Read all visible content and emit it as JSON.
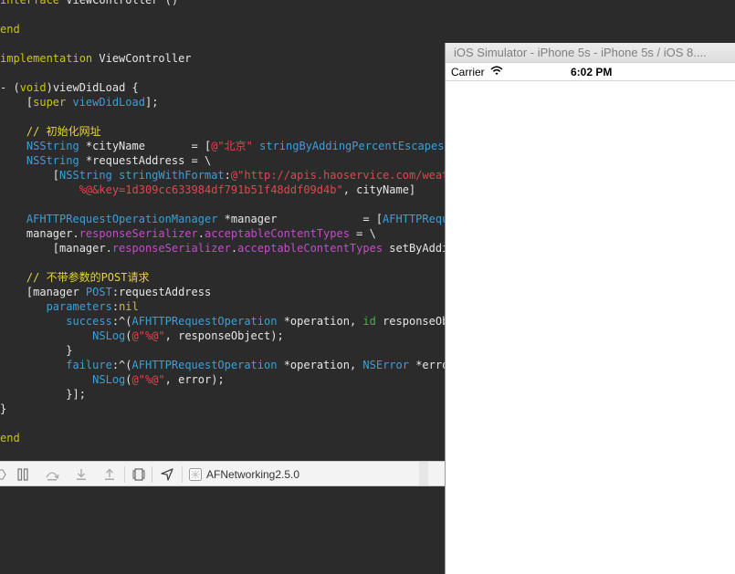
{
  "editor": {
    "lines": [
      [
        [
          "c-kw",
          "interface"
        ],
        [
          "c-pl",
          " ViewController ()"
        ]
      ],
      [],
      [
        [
          "c-kw",
          "end"
        ]
      ],
      [],
      [
        [
          "c-kw",
          "implementation"
        ],
        [
          "c-pl",
          " ViewController"
        ]
      ],
      [],
      [
        [
          "c-pl",
          "- ("
        ],
        [
          "c-kw",
          "void"
        ],
        [
          "c-pl",
          ")viewDidLoad {"
        ]
      ],
      [
        [
          "c-pl",
          "    ["
        ],
        [
          "c-kw",
          "super"
        ],
        [
          "c-pl",
          " "
        ],
        [
          "c-mt",
          "viewDidLoad"
        ],
        [
          "c-pl",
          "];"
        ]
      ],
      [],
      [
        [
          "c-cm",
          "    // 初始化网址"
        ]
      ],
      [
        [
          "c-ty",
          "    NSString"
        ],
        [
          "c-pl",
          " *cityName       = ["
        ],
        [
          "c-st",
          "@\"北京\""
        ],
        [
          "c-pl",
          " "
        ],
        [
          "c-mt",
          "stringByAddingPercentEscapesUsingEncoding"
        ]
      ],
      [
        [
          "c-ty",
          "    NSString"
        ],
        [
          "c-pl",
          " *requestAddress = \\"
        ]
      ],
      [
        [
          "c-pl",
          "        ["
        ],
        [
          "c-ty",
          "NSString"
        ],
        [
          "c-pl",
          " "
        ],
        [
          "c-mt",
          "stringWithFormat"
        ],
        [
          "c-pl",
          ":"
        ],
        [
          "c-st",
          "@\"http://apis.haoservice.com/weather"
        ]
      ],
      [
        [
          "c-st",
          "            %@&key=1d309cc633984df791b51f48ddf09d4b\""
        ],
        [
          "c-pl",
          ", cityName]"
        ]
      ],
      [],
      [
        [
          "c-ty",
          "    AFHTTPRequestOperationManager"
        ],
        [
          "c-pl",
          " *manager             = ["
        ],
        [
          "c-ty",
          "AFHTTPRequestOperationManager"
        ]
      ],
      [
        [
          "c-pl",
          "    manager."
        ],
        [
          "c-pr",
          "responseSerializer"
        ],
        [
          "c-pl",
          "."
        ],
        [
          "c-pr",
          "acceptableContentTypes"
        ],
        [
          "c-pl",
          " = \\"
        ]
      ],
      [
        [
          "c-pl",
          "        [manager."
        ],
        [
          "c-pr",
          "responseSerializer"
        ],
        [
          "c-pl",
          "."
        ],
        [
          "c-pr",
          "acceptableContentTypes"
        ],
        [
          "c-pl",
          " setByAddingObject"
        ]
      ],
      [],
      [
        [
          "c-cm",
          "    // 不带参数的POST请求"
        ]
      ],
      [
        [
          "c-pl",
          "    [manager "
        ],
        [
          "c-mt",
          "POST"
        ],
        [
          "c-pl",
          ":requestAddress"
        ]
      ],
      [
        [
          "c-mt",
          "       parameters"
        ],
        [
          "c-pl",
          ":"
        ],
        [
          "c-kw",
          "nil"
        ]
      ],
      [
        [
          "c-mt",
          "          success"
        ],
        [
          "c-pl",
          ":^("
        ],
        [
          "c-ty",
          "AFHTTPRequestOperation"
        ],
        [
          "c-pl",
          " *operation, "
        ],
        [
          "c-ot",
          "id"
        ],
        [
          "c-pl",
          " responseObject) {"
        ]
      ],
      [
        [
          "c-mt",
          "              NSLog"
        ],
        [
          "c-pl",
          "("
        ],
        [
          "c-st",
          "@\"%@\""
        ],
        [
          "c-pl",
          ", responseObject);"
        ]
      ],
      [
        [
          "c-pl",
          "          }"
        ]
      ],
      [
        [
          "c-mt",
          "          failure"
        ],
        [
          "c-pl",
          ":^("
        ],
        [
          "c-ty",
          "AFHTTPRequestOperation"
        ],
        [
          "c-pl",
          " *operation, "
        ],
        [
          "c-ty",
          "NSError"
        ],
        [
          "c-pl",
          " *error) {"
        ]
      ],
      [
        [
          "c-mt",
          "              NSLog"
        ],
        [
          "c-pl",
          "("
        ],
        [
          "c-st",
          "@\"%@\""
        ],
        [
          "c-pl",
          ", error);"
        ]
      ],
      [
        [
          "c-pl",
          "          }];"
        ]
      ],
      [
        [
          "c-pl",
          "}"
        ]
      ],
      [],
      [
        [
          "c-kw",
          "end"
        ]
      ]
    ]
  },
  "debug_bar": {
    "icons": [
      "breakpoints-toggle-icon",
      "pause-icon",
      "step-over-icon",
      "step-into-icon",
      "step-out-icon",
      "view-hierarchy-icon",
      "location-icon",
      "app-target-icon"
    ],
    "target_label": "AFNetworking2.5.0"
  },
  "simulator": {
    "title": "iOS Simulator - iPhone 5s - iPhone 5s / iOS 8....",
    "status_bar": {
      "carrier": "Carrier",
      "wifi_icon": "wifi-icon",
      "time": "6:02 PM"
    }
  }
}
